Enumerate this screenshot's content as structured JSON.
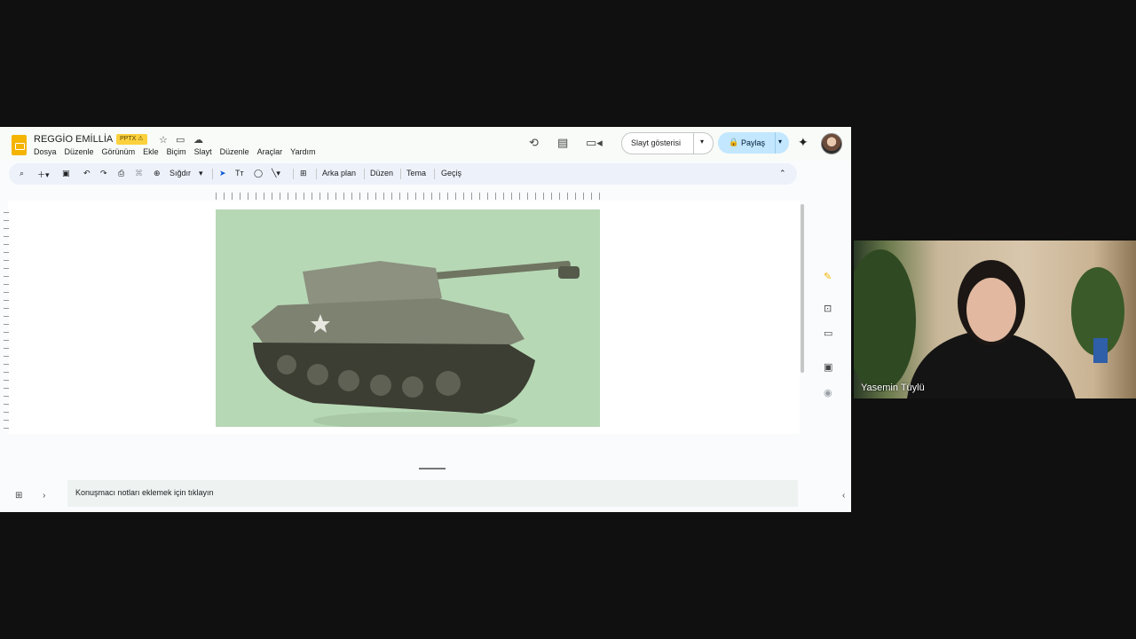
{
  "doc": {
    "title": "REGGİO EMİLLİA",
    "badge": "PPTX ⚠"
  },
  "menu": [
    "Dosya",
    "Düzenle",
    "Görünüm",
    "Ekle",
    "Biçim",
    "Slayt",
    "Düzenle",
    "Araçlar",
    "Yardım"
  ],
  "header": {
    "slideshow_label": "Slayt gösterisi",
    "share_label": "Paylaş"
  },
  "toolbar": {
    "zoom_label": "Sığdır",
    "background": "Arka plan",
    "layout": "Düzen",
    "theme": "Tema",
    "transition": "Geçiş"
  },
  "notes": {
    "placeholder": "Konuşmacı notları eklemek için tıklayın"
  },
  "video": {
    "participant_name": "Yasemin Tüylü"
  }
}
